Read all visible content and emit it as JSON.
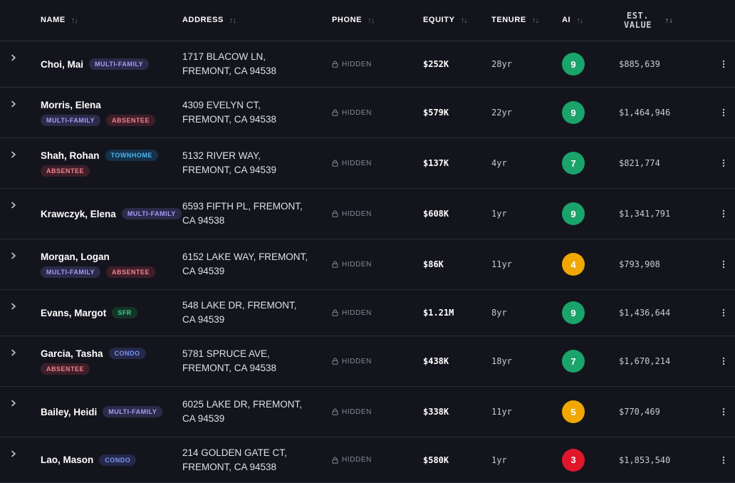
{
  "columns": {
    "name": "NAME",
    "address": "ADDRESS",
    "phone": "PHONE",
    "equity": "EQUITY",
    "tenure": "TENURE",
    "ai": "AI",
    "est_value_line1": "EST.",
    "est_value_line2": "VALUE",
    "sort_glyph": "↑↓"
  },
  "colors": {
    "ai_high": "#1aa36a",
    "ai_mid": "#f0a800",
    "ai_low": "#e0162b"
  },
  "rows": [
    {
      "name": "Choi, Mai",
      "tags": [
        "MULTI-FAMILY"
      ],
      "addr1": "1717 BLACOW LN,",
      "addr2": "FREMONT, CA 94538",
      "phone": "HIDDEN",
      "equity": "$252K",
      "tenure": "28yr",
      "ai": "9",
      "est": "$885,639"
    },
    {
      "name": "Morris, Elena",
      "tags": [
        "MULTI-FAMILY",
        "ABSENTEE"
      ],
      "addr1": "4309 EVELYN CT,",
      "addr2": "FREMONT, CA 94538",
      "phone": "HIDDEN",
      "equity": "$579K",
      "tenure": "22yr",
      "ai": "9",
      "est": "$1,464,946"
    },
    {
      "name": "Shah, Rohan",
      "tags": [
        "TOWNHOME",
        "ABSENTEE"
      ],
      "addr1": "5132 RIVER WAY,",
      "addr2": "FREMONT, CA 94539",
      "phone": "HIDDEN",
      "equity": "$137K",
      "tenure": "4yr",
      "ai": "7",
      "est": "$821,774"
    },
    {
      "name": "Krawczyk, Elena",
      "tags": [
        "MULTI-FAMILY"
      ],
      "addr1": "6593 FIFTH PL, FREMONT,",
      "addr2": "CA 94538",
      "phone": "HIDDEN",
      "equity": "$608K",
      "tenure": "1yr",
      "ai": "9",
      "est": "$1,341,791"
    },
    {
      "name": "Morgan, Logan",
      "tags": [
        "MULTI-FAMILY",
        "ABSENTEE"
      ],
      "addr1": "6152 LAKE WAY, FREMONT,",
      "addr2": "CA 94539",
      "phone": "HIDDEN",
      "equity": "$86K",
      "tenure": "11yr",
      "ai": "4",
      "est": "$793,908"
    },
    {
      "name": "Evans, Margot",
      "tags": [
        "SFR"
      ],
      "addr1": "548 LAKE DR, FREMONT,",
      "addr2": "CA 94539",
      "phone": "HIDDEN",
      "equity": "$1.21M",
      "tenure": "8yr",
      "ai": "9",
      "est": "$1,436,644"
    },
    {
      "name": "Garcia, Tasha",
      "tags": [
        "CONDO",
        "ABSENTEE"
      ],
      "addr1": "5781 SPRUCE AVE,",
      "addr2": "FREMONT, CA 94538",
      "phone": "HIDDEN",
      "equity": "$438K",
      "tenure": "18yr",
      "ai": "7",
      "est": "$1,670,214"
    },
    {
      "name": "Bailey, Heidi",
      "tags": [
        "MULTI-FAMILY"
      ],
      "addr1": "6025 LAKE DR, FREMONT,",
      "addr2": "CA 94539",
      "phone": "HIDDEN",
      "equity": "$338K",
      "tenure": "11yr",
      "ai": "5",
      "est": "$770,469"
    },
    {
      "name": "Lao, Mason",
      "tags": [
        "CONDO"
      ],
      "addr1": "214 GOLDEN GATE CT,",
      "addr2": "FREMONT, CA 94538",
      "phone": "HIDDEN",
      "equity": "$580K",
      "tenure": "1yr",
      "ai": "3",
      "est": "$1,853,540"
    }
  ]
}
